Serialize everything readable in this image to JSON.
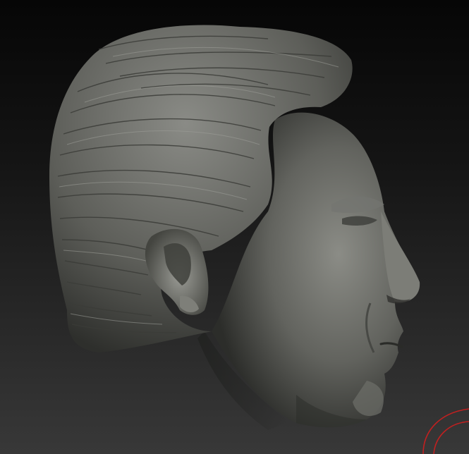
{
  "viewport": {
    "background_top": "#060606",
    "background_bottom": "#383838"
  },
  "model": {
    "material_color": "#5b5c57",
    "highlight_color": "#8e8f89",
    "shadow_color": "#2a2b28"
  },
  "gizmo": {
    "icon": "rotation-gizmo-icon",
    "color": "#c02020"
  }
}
